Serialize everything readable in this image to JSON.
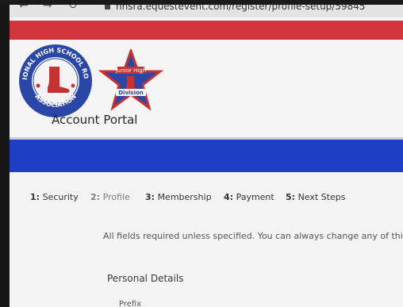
{
  "browser": {
    "url": "nhsra.equestevent.com/register/profile-setup/59845",
    "back_icon": "arrow-left-icon",
    "forward_icon": "arrow-right-icon",
    "reload_icon": "reload-icon",
    "lock_icon": "lock-icon"
  },
  "header": {
    "logo1_ring_top": "NATIONAL HIGH SCHOOL RODEO",
    "logo1_ring_bottom": "ASSOCIATION",
    "logo2_top": "Junior High",
    "logo2_bottom": "Division",
    "portal_title": "Account Portal"
  },
  "steps": [
    {
      "num": "1:",
      "label": "Security"
    },
    {
      "num": "2:",
      "label": "Profile"
    },
    {
      "num": "3:",
      "label": "Membership"
    },
    {
      "num": "4:",
      "label": "Payment"
    },
    {
      "num": "5:",
      "label": "Next Steps"
    }
  ],
  "form": {
    "note": "All fields required unless specified. You can always change any of this in",
    "section_title": "Personal Details",
    "first_field_label": "Prefix"
  },
  "colors": {
    "red_band": "#d3343a",
    "blue_band": "#1d3fc4",
    "logo_blue": "#2a47a8",
    "logo_red": "#c43232"
  }
}
